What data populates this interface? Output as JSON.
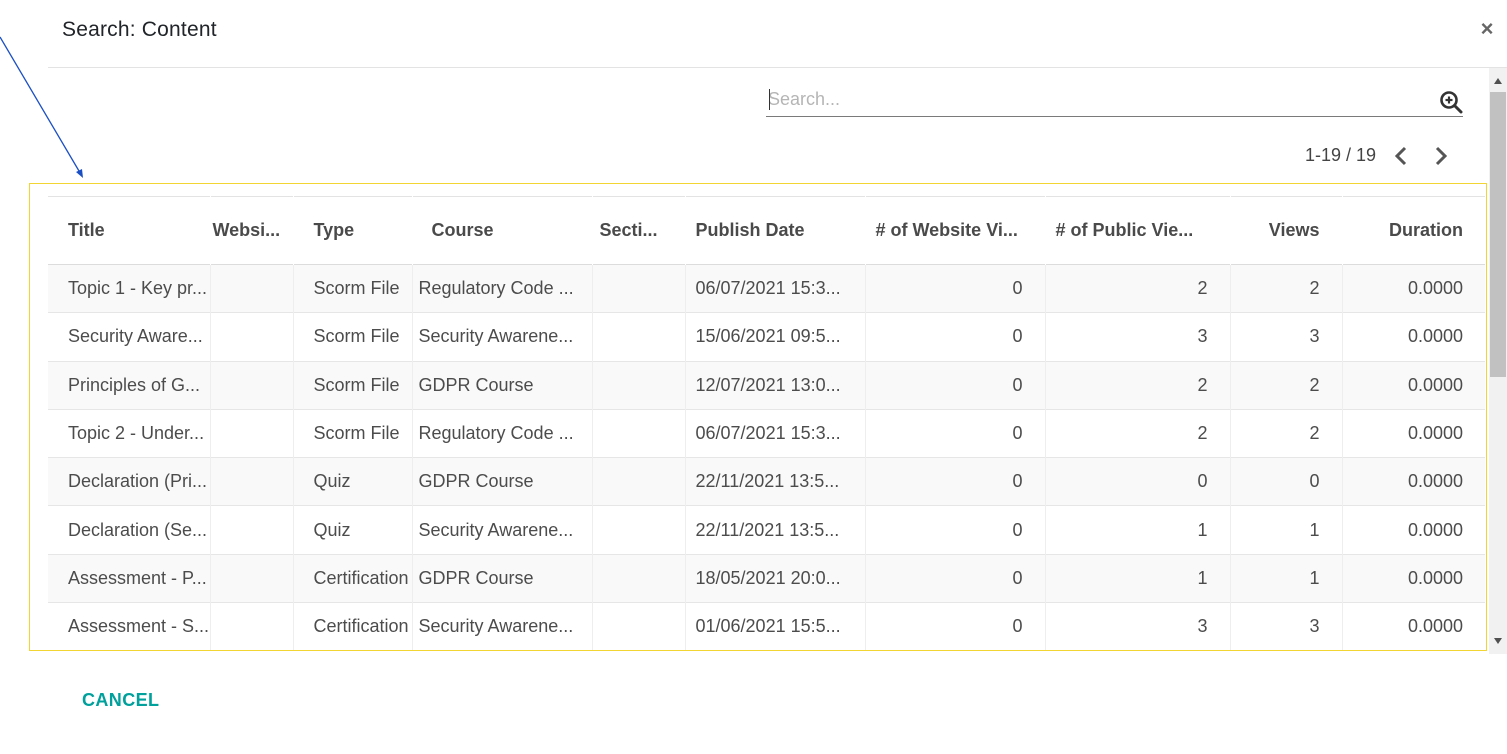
{
  "dialog": {
    "title": "Search: Content",
    "close_label": "×"
  },
  "search": {
    "placeholder": "Search...",
    "value": ""
  },
  "pager": {
    "value": "1-19 / 19"
  },
  "table": {
    "columns": [
      "Title",
      "Websi...",
      "Type",
      "Course",
      "Secti...",
      "Publish Date",
      "# of Website Vi...",
      "# of Public Vie...",
      "Views",
      "Duration"
    ],
    "rows": [
      {
        "title": "Topic 1 - Key pr...",
        "website": "",
        "type": "Scorm File",
        "course": "Regulatory Code ...",
        "section": "",
        "publish_date": "06/07/2021 15:3...",
        "website_views": "0",
        "public_views": "2",
        "views": "2",
        "duration": "0.0000"
      },
      {
        "title": "Security Aware...",
        "website": "",
        "type": "Scorm File",
        "course": "Security Awarene...",
        "section": "",
        "publish_date": "15/06/2021 09:5...",
        "website_views": "0",
        "public_views": "3",
        "views": "3",
        "duration": "0.0000"
      },
      {
        "title": "Principles of G...",
        "website": "",
        "type": "Scorm File",
        "course": "GDPR Course",
        "section": "",
        "publish_date": "12/07/2021 13:0...",
        "website_views": "0",
        "public_views": "2",
        "views": "2",
        "duration": "0.0000"
      },
      {
        "title": "Topic 2 - Under...",
        "website": "",
        "type": "Scorm File",
        "course": "Regulatory Code ...",
        "section": "",
        "publish_date": "06/07/2021 15:3...",
        "website_views": "0",
        "public_views": "2",
        "views": "2",
        "duration": "0.0000"
      },
      {
        "title": "Declaration (Pri...",
        "website": "",
        "type": "Quiz",
        "course": "GDPR Course",
        "section": "",
        "publish_date": "22/11/2021 13:5...",
        "website_views": "0",
        "public_views": "0",
        "views": "0",
        "duration": "0.0000"
      },
      {
        "title": "Declaration (Se...",
        "website": "",
        "type": "Quiz",
        "course": "Security Awarene...",
        "section": "",
        "publish_date": "22/11/2021 13:5...",
        "website_views": "0",
        "public_views": "1",
        "views": "1",
        "duration": "0.0000"
      },
      {
        "title": "Assessment - P...",
        "website": "",
        "type": "Certification",
        "course": "GDPR Course",
        "section": "",
        "publish_date": "18/05/2021 20:0...",
        "website_views": "0",
        "public_views": "1",
        "views": "1",
        "duration": "0.0000"
      },
      {
        "title": "Assessment - S...",
        "website": "",
        "type": "Certification",
        "course": "Security Awarene...",
        "section": "",
        "publish_date": "01/06/2021 15:5...",
        "website_views": "0",
        "public_views": "3",
        "views": "3",
        "duration": "0.0000"
      }
    ]
  },
  "footer": {
    "cancel_label": "CANCEL"
  },
  "colors": {
    "accent": "#00a09d",
    "highlight": "#f2d533",
    "annotation_arrow": "#1a4fc4"
  },
  "icons": {
    "search": "search-plus-icon",
    "prev": "chevron-left-icon",
    "next": "chevron-right-icon",
    "close": "close-icon"
  }
}
